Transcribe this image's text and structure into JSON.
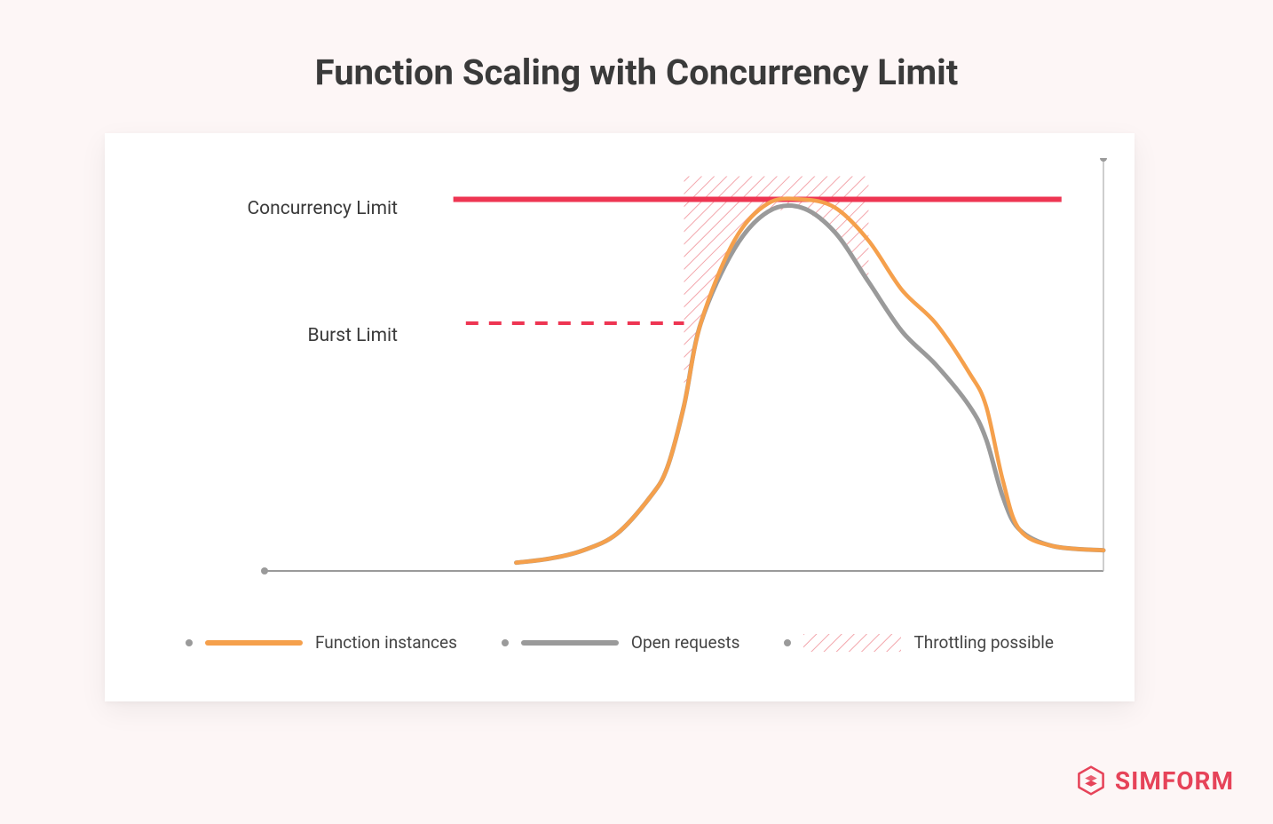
{
  "chart_data": {
    "type": "line",
    "title": "Function Scaling with Concurrency Limit",
    "xlabel": "",
    "ylabel": "",
    "xlim": [
      0,
      100
    ],
    "ylim": [
      0,
      100
    ],
    "reference_lines": [
      {
        "name": "Concurrency Limit",
        "y": 90,
        "style": "solid",
        "color": "#ee3552"
      },
      {
        "name": "Burst Limit",
        "y": 60,
        "style": "dashed",
        "color": "#ee3552"
      }
    ],
    "series": [
      {
        "name": "Open requests",
        "color": "#9a9a9a",
        "x": [
          30,
          34,
          38,
          42,
          46,
          48,
          50,
          52,
          56,
          60,
          64,
          68,
          72,
          76,
          80,
          84,
          86,
          88,
          90,
          94,
          100
        ],
        "values": [
          2,
          3,
          5,
          9,
          18,
          25,
          40,
          60,
          78,
          87,
          88,
          82,
          70,
          58,
          50,
          40,
          32,
          18,
          10,
          6,
          5
        ]
      },
      {
        "name": "Function instances",
        "color": "#f5a04c",
        "x": [
          30,
          34,
          38,
          42,
          46,
          48,
          50,
          52,
          56,
          60,
          64,
          68,
          72,
          76,
          80,
          84,
          86,
          88,
          90,
          94,
          100
        ],
        "values": [
          2,
          3,
          5,
          9,
          18,
          25,
          40,
          60,
          80,
          89,
          90,
          88,
          80,
          68,
          60,
          48,
          40,
          22,
          10,
          6,
          5
        ]
      }
    ],
    "throttling_region": {
      "name": "Throttling possible",
      "description": "area between Open requests curve and Concurrency Limit where requests may be throttled",
      "approx_x_range": [
        50,
        75
      ],
      "bounded_by": [
        "Open requests",
        "Concurrency Limit"
      ]
    },
    "legend": {
      "items": [
        {
          "key": "function_instances",
          "label": "Function instances",
          "swatch": "orange-line"
        },
        {
          "key": "open_requests",
          "label": "Open requests",
          "swatch": "gray-line"
        },
        {
          "key": "throttling_possible",
          "label": "Throttling possible",
          "swatch": "red-hatch"
        }
      ]
    }
  },
  "annotations": {
    "concurrency": "Concurrency Limit",
    "burst": "Burst Limit"
  },
  "legend_labels": {
    "function_instances": "Function instances",
    "open_requests": "Open requests",
    "throttling_possible": "Throttling possible"
  },
  "brand": "SIMFORM",
  "colors": {
    "accent_red": "#ee3552",
    "orange": "#f5a04c",
    "gray": "#9a9a9a",
    "brand": "#e64359"
  }
}
